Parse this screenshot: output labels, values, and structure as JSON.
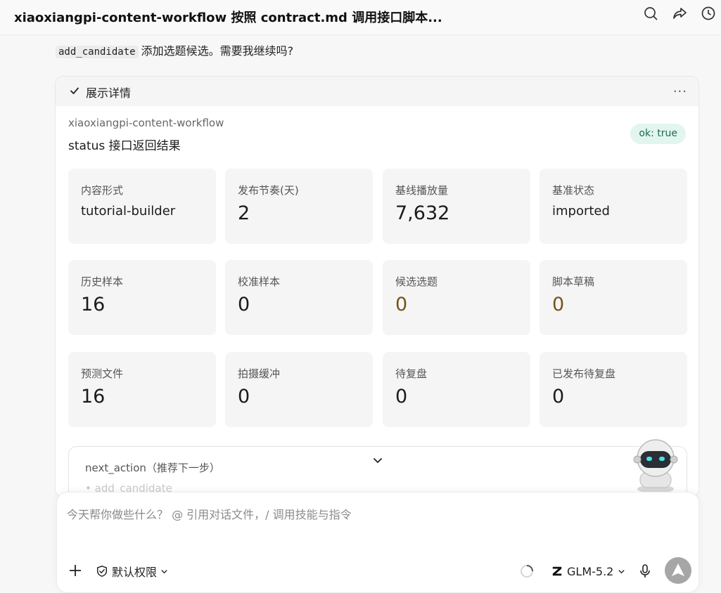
{
  "header": {
    "title": "xiaoxiangpi-content-workflow 按照 contract.md 调用接口脚本..."
  },
  "intro": {
    "code": "add_candidate",
    "text": "添加选题候选。需要我继续吗?"
  },
  "details": {
    "toggle_label": "展示详情",
    "more_label": "...",
    "workflow_name": "xiaoxiangpi-content-workflow",
    "subtitle": "status 接口返回结果",
    "badge": "ok: true",
    "tiles": [
      {
        "label": "内容形式",
        "value": "tutorial-builder"
      },
      {
        "label": "发布节奏(天)",
        "value": "2"
      },
      {
        "label": "基线播放量",
        "value": "7,632"
      },
      {
        "label": "基准状态",
        "value": "imported"
      },
      {
        "label": "历史样本",
        "value": "16"
      },
      {
        "label": "校准样本",
        "value": "0"
      },
      {
        "label": "候选选题",
        "value": "0"
      },
      {
        "label": "脚本草稿",
        "value": "0"
      },
      {
        "label": "预测文件",
        "value": "16"
      },
      {
        "label": "拍摄缓冲",
        "value": "0"
      },
      {
        "label": "待复盘",
        "value": "0"
      },
      {
        "label": "已发布待复盘",
        "value": "0"
      }
    ],
    "next_action_label": "next_action（推荐下一步）",
    "next_action_item": "add_candidate"
  },
  "composer": {
    "placeholder": "今天帮你做些什么？ @ 引用对话文件，/ 调用技能与指令",
    "permission_label": "默认权限",
    "model_label": "GLM-5.2"
  },
  "colors": {
    "accent_badge_bg": "#e2f5ee",
    "accent_badge_text": "#1e6b4f",
    "warn_value": "#7a5219",
    "send_button": "#a6a6a6"
  }
}
